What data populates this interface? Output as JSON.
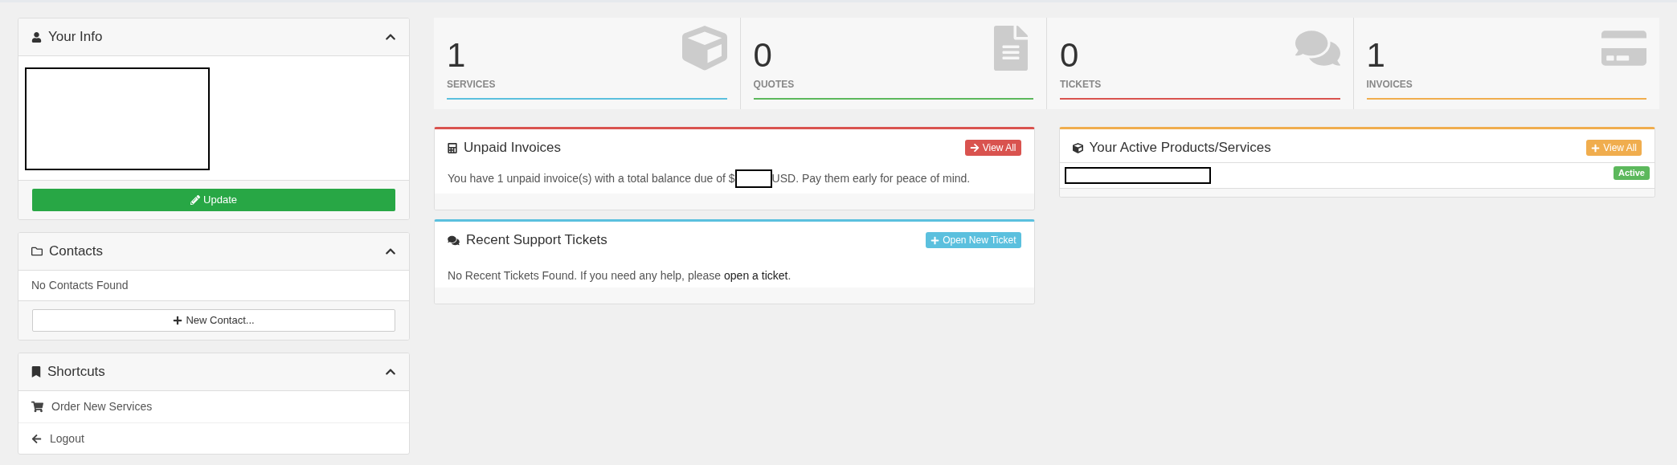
{
  "sidebar": {
    "your_info": {
      "title": "Your Info",
      "expanded": true,
      "button": "Update"
    },
    "contacts": {
      "title": "Contacts",
      "expanded": true,
      "empty_text": "No Contacts Found",
      "button": "New Contact..."
    },
    "shortcuts": {
      "title": "Shortcuts",
      "expanded": true,
      "items": [
        {
          "kind": "cart",
          "label": "Order New Services"
        },
        {
          "kind": "back",
          "label": "Logout"
        }
      ]
    }
  },
  "stats": [
    {
      "kind": "services",
      "value": "1",
      "label": "SERVICES",
      "color": "#5bc0de"
    },
    {
      "kind": "quotes",
      "value": "0",
      "label": "QUOTES",
      "color": "#5cb85c"
    },
    {
      "kind": "tickets",
      "value": "0",
      "label": "TICKETS",
      "color": "#d9534f"
    },
    {
      "kind": "invoices",
      "value": "1",
      "label": "INVOICES",
      "color": "#f0ad4e"
    }
  ],
  "unpaid_invoices": {
    "title": "Unpaid Invoices",
    "color": "#d9534f",
    "button": "View All",
    "text_before": "You have 1 unpaid invoice(s) with a total balance due of $",
    "text_after": "USD. Pay them early for peace of mind."
  },
  "support_tickets": {
    "title": "Recent Support Tickets",
    "color": "#5bc0de",
    "button": "Open New Ticket",
    "text_before": "No Recent Tickets Found. If you need any help, please ",
    "link": "open a ticket",
    "text_after": "."
  },
  "active_products": {
    "title": "Your Active Products/Services",
    "color": "#f0ad4e",
    "button": "View All",
    "rows": [
      {
        "status": "Active"
      }
    ]
  }
}
